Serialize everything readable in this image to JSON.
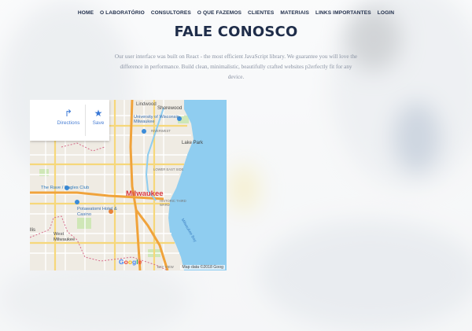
{
  "nav": {
    "items": [
      "HOME",
      "O LABORATÓRIO",
      "CONSULTORES",
      "O QUE FAZEMOS",
      "CLIENTES",
      "MATERIAIS",
      "LINKS IMPORTANTES",
      "LOGIN"
    ]
  },
  "page_title": "FALE CONOSCO",
  "intro": "Our user interface was built on React - the most efficient JavaScript library. We guarantee you will love the difference in performance. Build clean, minimalistic, beautifully crafted websites p2erfectly fit for any device.",
  "map": {
    "directions_label": "Directions",
    "save_label": "Save",
    "attribution": "Map data ©2018 Goog",
    "google_logo": "Google",
    "place_labels": {
      "city": "Milwaukee",
      "shorewood": "Shorewood",
      "university": "University of Wisconsin-Milwaukee",
      "lake_park": "Lake Park",
      "rave": "The Rave / Eagles Club",
      "potawatomi": "Potawatomi Hotel & Casino",
      "west_milwaukee": "West Milwaukee",
      "bay": "Milwaukee Bay",
      "lower_east_side": "LOWER EAST SIDE",
      "historic_third": "HISTORIC THIRD WARD",
      "riverwest": "RIVERWEST",
      "bay_view": "BAY VIEW",
      "ellis": "llis",
      "lindwood": "Lindwood"
    }
  },
  "colors": {
    "navy": "#1f2d4a",
    "lake": "#8fcdf0",
    "map_land": "#f0ece4",
    "city_red": "#d8353c"
  }
}
